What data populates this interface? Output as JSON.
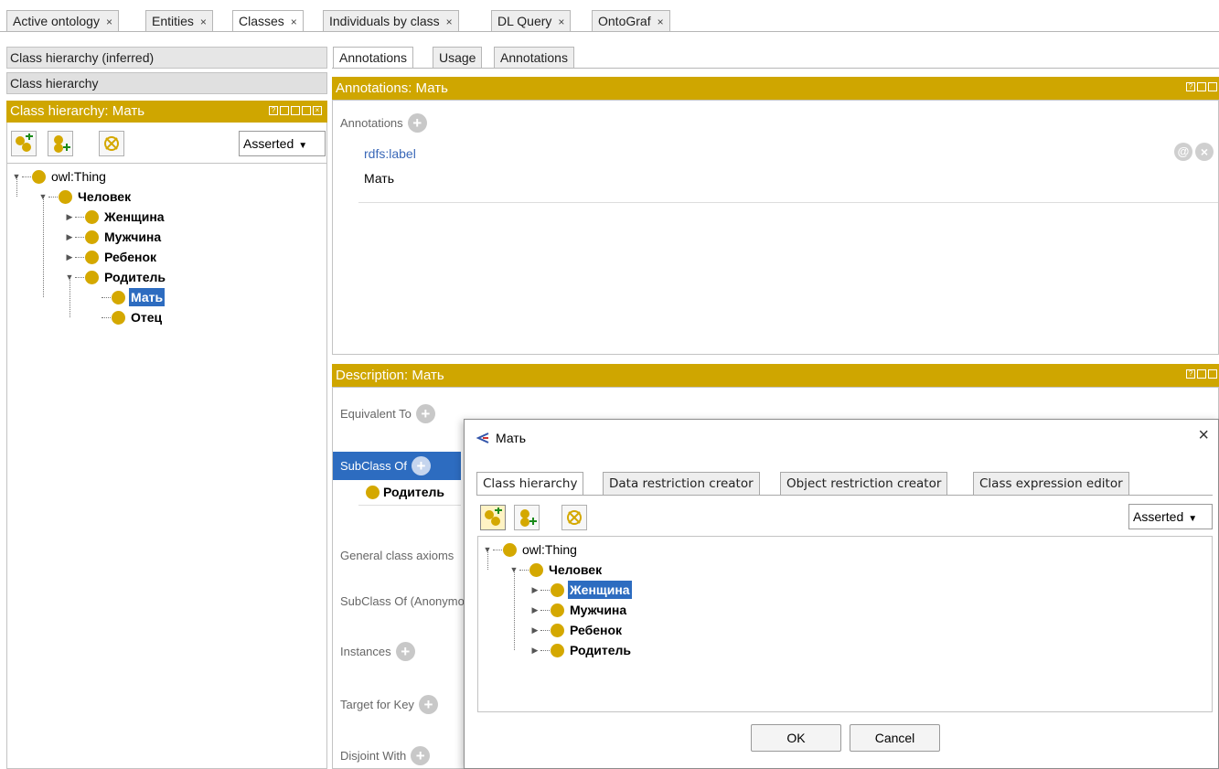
{
  "top_tabs": [
    {
      "label": "Active ontology",
      "close": "×"
    },
    {
      "label": "Entities",
      "close": "×"
    },
    {
      "label": "Classes",
      "close": "×"
    },
    {
      "label": "Individuals by class",
      "close": "×"
    },
    {
      "label": "DL Query",
      "close": "×"
    },
    {
      "label": "OntoGraf",
      "close": "×"
    }
  ],
  "left": {
    "subtabs": [
      "Class hierarchy (inferred)",
      "Class hierarchy"
    ],
    "header": "Class hierarchy: Мать",
    "dropdown": "Asserted",
    "tree": [
      "owl:Thing",
      "Человек",
      "Женщина",
      "Мужчина",
      "Ребенок",
      "Родитель",
      "Мать",
      "Отец"
    ]
  },
  "right": {
    "subtabs": [
      "Annotations",
      "Usage",
      "Annotations"
    ],
    "annotations_header": "Annotations: Мать",
    "annotations_label": "Annotations",
    "annotation_property": "rdfs:label",
    "annotation_value": "Мать",
    "annotation_icons": {
      "at": "@",
      "delete": "×"
    },
    "description_header": "Description: Мать",
    "sections": {
      "equivalent_to": "Equivalent To",
      "subclass_of": "SubClass Of",
      "subclass_value": "Родитель",
      "general_axioms": "General class axioms",
      "subclass_anon": "SubClass Of (Anonymous Ancestor)",
      "instances": "Instances",
      "target_for_key": "Target for Key",
      "disjoint_with": "Disjoint With"
    }
  },
  "dialog": {
    "title": "Мать",
    "close": "×",
    "tabs": [
      "Class hierarchy",
      "Data restriction creator",
      "Object restriction creator",
      "Class expression editor"
    ],
    "dropdown": "Asserted",
    "tree": [
      "owl:Thing",
      "Человек",
      "Женщина",
      "Мужчина",
      "Ребенок",
      "Родитель"
    ],
    "ok": "OK",
    "cancel": "Cancel"
  },
  "colors": {
    "accent_gold": "#cfa600",
    "selection": "#2d6cc0",
    "class_dot": "#d4a800"
  },
  "icons": [
    "add-subclass-icon",
    "add-sibling-class-icon",
    "delete-class-icon",
    "help-icon",
    "close-icon",
    "plus-icon",
    "protege-logo-icon"
  ]
}
